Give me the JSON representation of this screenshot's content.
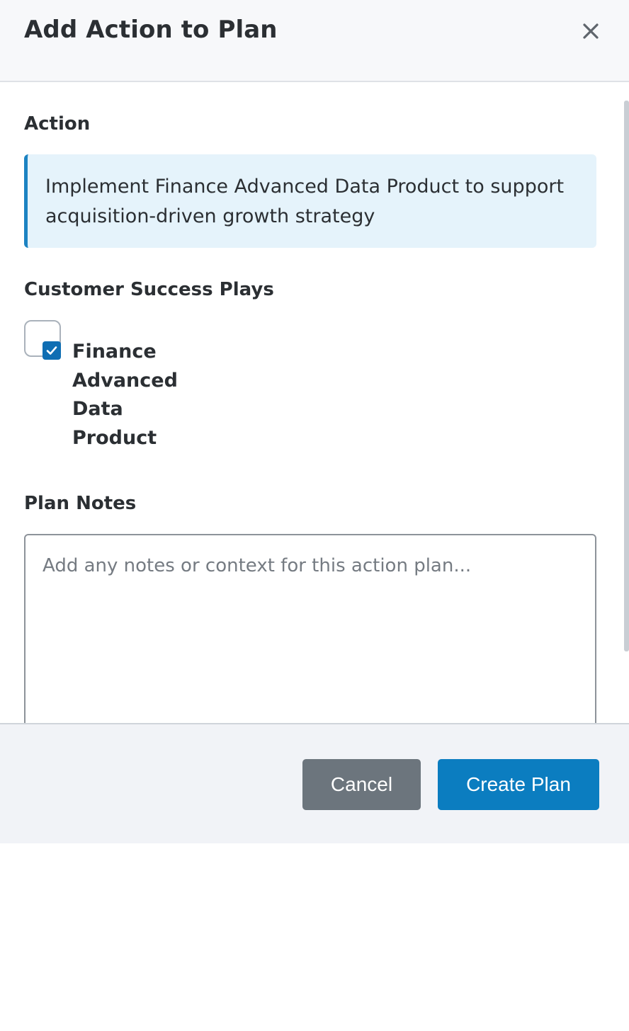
{
  "header": {
    "title": "Add Action to Plan",
    "close_icon": "close-icon"
  },
  "action_section": {
    "label": "Action",
    "text": "Implement Finance Advanced Data Product to support acquisition-driven growth strategy"
  },
  "plays_section": {
    "label": "Customer Success Plays",
    "items": [
      {
        "label": "Finance Advanced Data Product",
        "checked": true
      }
    ]
  },
  "notes_section": {
    "label": "Plan Notes",
    "placeholder": "Add any notes or context for this action plan...",
    "value": ""
  },
  "footer": {
    "cancel_label": "Cancel",
    "create_label": "Create Plan"
  },
  "colors": {
    "primary": "#0b7dc0",
    "secondary": "#6c757d",
    "info_background": "#e5f3fb",
    "info_border": "#1c83c2"
  }
}
